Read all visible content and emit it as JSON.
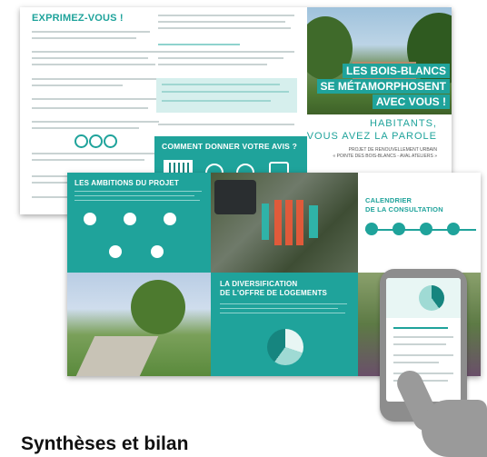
{
  "back_sheet": {
    "heading": "EXPRIMEZ-VOUS !",
    "hero_title": [
      "LES BOIS-BLANCS",
      "SE MÉTAMORPHOSENT",
      "AVEC VOUS !"
    ],
    "habitants": [
      "HABITANTS,",
      "VOUS AVEZ LA PAROLE"
    ],
    "subtitle": [
      "PROJET DE RENOUVELLEMENT URBAIN",
      "« POINTE DES BOIS-BLANCS - AVAL ATELIERS »"
    ],
    "cta_title": "COMMENT DONNER VOTRE AVIS ?"
  },
  "front_sheet": {
    "ambitions_title": "LES AMBITIONS DU PROJET",
    "calendar_title": [
      "CALENDRIER",
      "DE LA CONSULTATION"
    ],
    "diversification_title": [
      "LA DIVERSIFICATION",
      "DE L'OFFRE DE LOGEMENTS"
    ]
  },
  "caption": "Synthèses et bilan",
  "colors": {
    "teal": "#1fa39b",
    "dark_teal": "#16857f"
  }
}
